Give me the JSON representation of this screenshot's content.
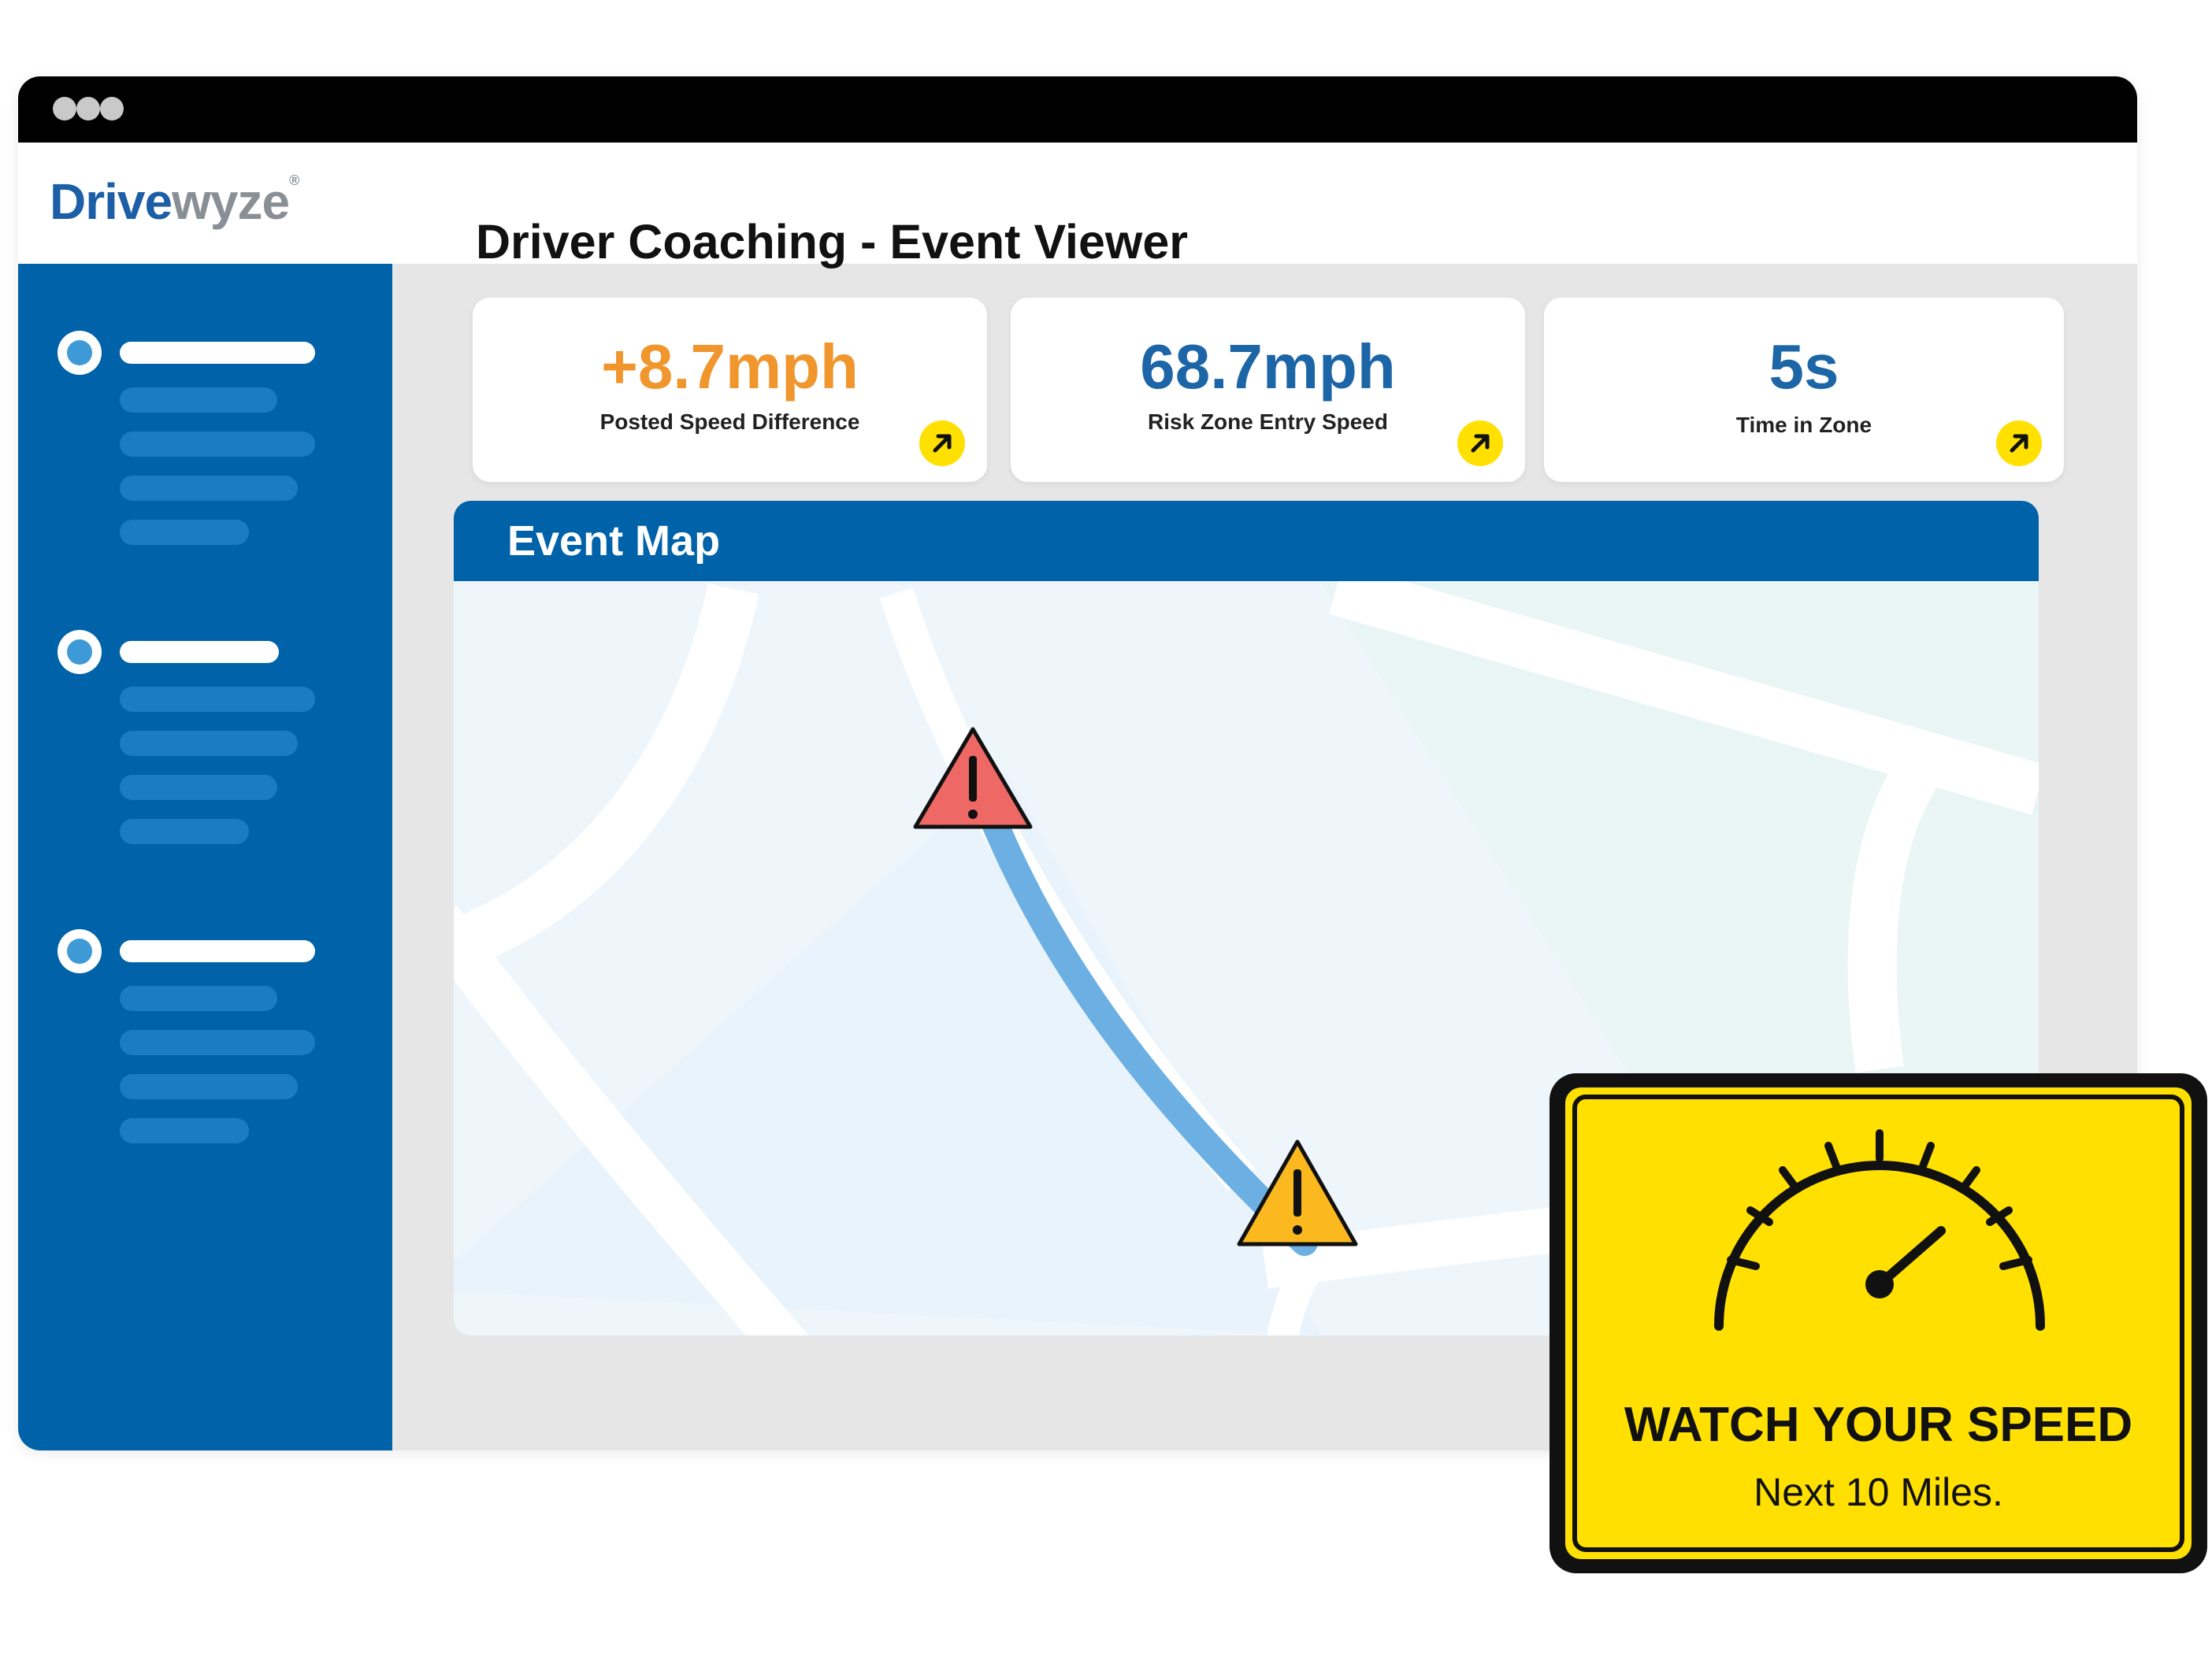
{
  "brand": {
    "logo_part1": "Drive",
    "logo_part2": "wyze",
    "trademark": "®"
  },
  "page": {
    "title": "Driver Coaching - Event Viewer"
  },
  "metrics": [
    {
      "value": "+8.7mph",
      "label": "Posted Speed Difference",
      "color": "#f0962d"
    },
    {
      "value": "68.7mph",
      "label": "Risk Zone Entry Speed",
      "color": "#1c66a8"
    },
    {
      "value": "5s",
      "label": "Time in Zone",
      "color": "#1c66a8"
    }
  ],
  "map": {
    "title": "Event Map",
    "route_color": "#6cb0e3",
    "markers": [
      {
        "icon": "warning-icon",
        "severity": "high",
        "color": "#ee6866"
      },
      {
        "icon": "warning-icon",
        "severity": "medium",
        "color": "#fcb81f"
      }
    ]
  },
  "sign": {
    "headline": "WATCH YOUR SPEED",
    "subline": "Next 10 Miles.",
    "icon": "speedometer-icon",
    "color": "#ffe000"
  },
  "colors": {
    "primary": "#0062a8",
    "accent_yellow": "#ffe000"
  }
}
